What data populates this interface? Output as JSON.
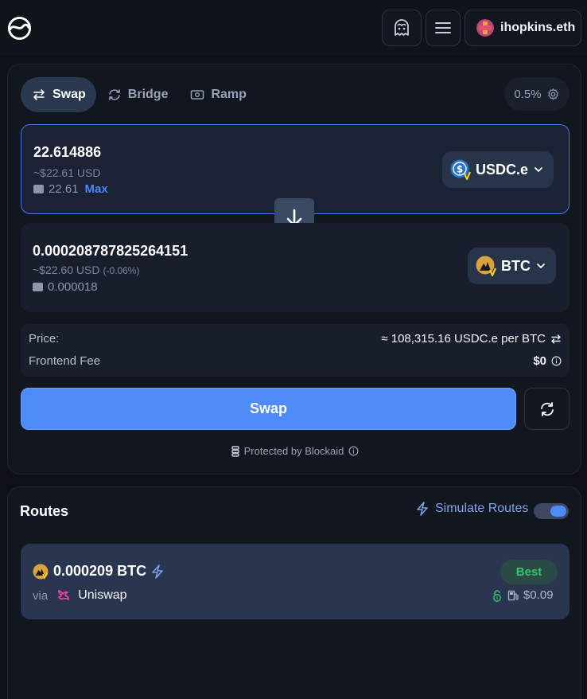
{
  "header": {
    "account_label": "ihopkins.eth",
    "icons": [
      "app-logo-icon",
      "ghost-icon",
      "menu-icon",
      "avatar"
    ]
  },
  "tabs": [
    {
      "label": "Swap",
      "icon": "swap-arrows-icon",
      "active": true
    },
    {
      "label": "Bridge",
      "icon": "bridge-refresh-icon",
      "active": false
    },
    {
      "label": "Ramp",
      "icon": "ramp-cash-icon",
      "active": false
    }
  ],
  "slippage": {
    "label": "0.5%",
    "icon": "gear-icon"
  },
  "from": {
    "amount": "22.614886",
    "usd": "~$22.61 USD",
    "balance": "22.61",
    "max_label": "Max",
    "token": "USDC.e"
  },
  "to": {
    "amount": "0.000208787825264151",
    "usd": "~$22.60 USD",
    "usd_change": "(-0.06%)",
    "balance": "0.000018",
    "token": "BTC"
  },
  "info": {
    "price_label": "Price:",
    "price_value": "≈ 108,315.16 USDC.e per BTC",
    "fee_label": "Frontend Fee",
    "fee_value": "$0"
  },
  "actions": {
    "swap_label": "Swap",
    "protected_label": "Protected by Blockaid"
  },
  "routes": {
    "title": "Routes",
    "simulate_label": "Simulate Routes",
    "simulate_enabled": true,
    "items": [
      {
        "amount": "0.000209 BTC",
        "via_label": "via",
        "dex": "Uniswap",
        "badge": "Best",
        "gas": "$0.09"
      }
    ]
  },
  "colors": {
    "accent": "#4e8bf6",
    "background": "#0d1016",
    "card": "#12161e",
    "best_green": "#37c26f"
  }
}
